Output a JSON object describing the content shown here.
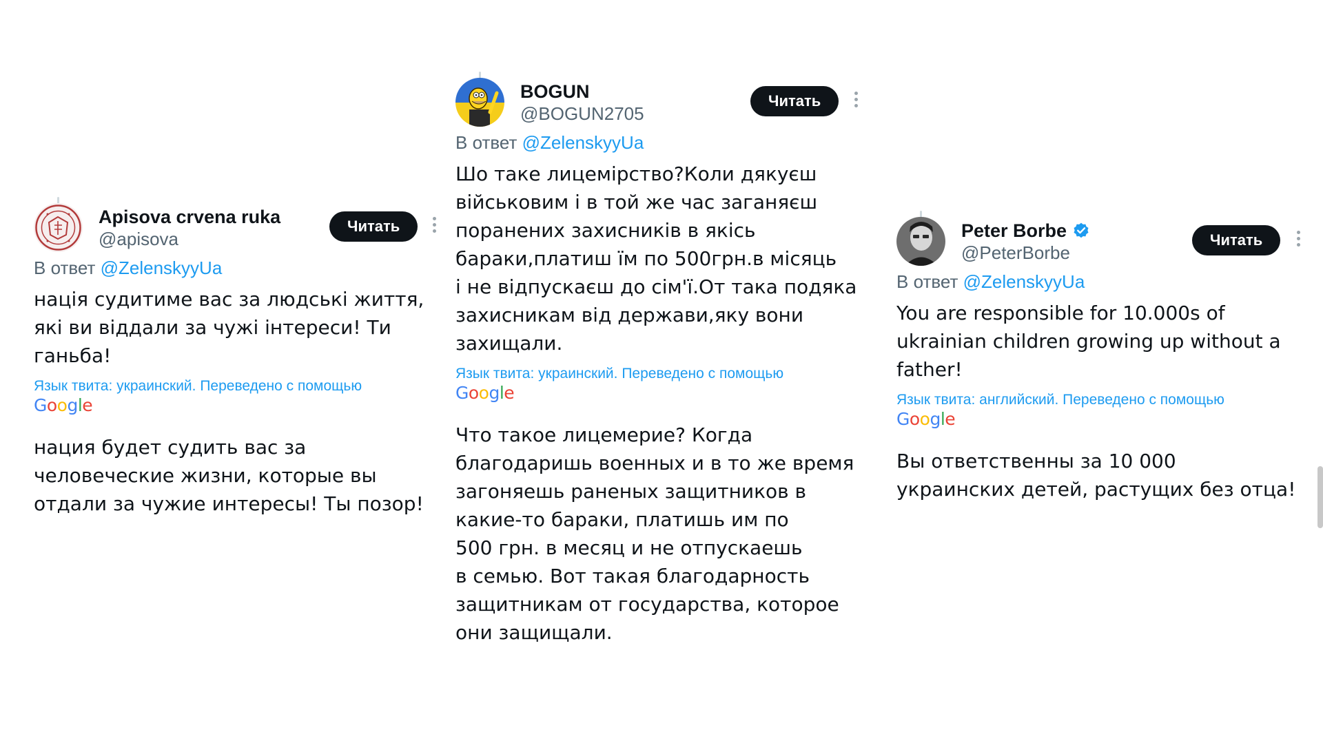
{
  "tweets": [
    {
      "display_name": "Apisova crvena ruka",
      "handle": "@apisova",
      "follow_label": "Читать",
      "reply_prefix": "В ответ",
      "reply_to": "@ZelenskyyUa",
      "text": "нація судитиме вас за людські життя,\nякі ви віддали за чужі інтереси! Ти\nганьба!",
      "translate_note": "Язык твита: украинский. Переведено с помощью",
      "translated_text": "нация будет судить вас за\nчеловеческие жизни, которые вы\nотдали за чужие интересы! Ты позор!",
      "avatar_icon": "seal-emblem-avatar",
      "verified": false
    },
    {
      "display_name": "BOGUN",
      "handle": "@BOGUN2705",
      "follow_label": "Читать",
      "reply_prefix": "В ответ",
      "reply_to": "@ZelenskyyUa",
      "text": "Шо таке лицемірство?Коли дякуєш\nвійськовим і в той же час заганяєш\nпоранених захисників в якісь\nбараки,платиш їм по 500грн.в місяць\nі не відпускаєш до сім'ї.От така подяка\nзахисникам від держави,яку вони\nзахищали.",
      "translate_note": "Язык твита: украинский. Переведено с помощью",
      "translated_text": "Что такое лицемерие? Когда\nблагодаришь военных и в то же время\nзагоняешь раненых защитников в\nкакие-то бараки, платишь им по\n500 грн. в месяц и не отпускаешь\nв семью. Вот такая благодарность\nзащитникам от государства, которое\nони защищали.",
      "avatar_icon": "cartoon-character-avatar",
      "verified": false
    },
    {
      "display_name": "Peter Borbe",
      "handle": "@PeterBorbe",
      "follow_label": "Читать",
      "reply_prefix": "В ответ",
      "reply_to": "@ZelenskyyUa",
      "text": "You are responsible for 10.000s of\nukrainian children growing up without a\nfather!",
      "translate_note": "Язык твита: английский. Переведено с помощью",
      "translated_text": "Вы ответственны за 10 000\nукраинских детей, растущих без отца!",
      "avatar_icon": "profile-photo-avatar",
      "verified": true
    }
  ],
  "google_logo": {
    "letters": [
      "G",
      "o",
      "o",
      "g",
      "l",
      "e"
    ],
    "colors": [
      "#4285f4",
      "#ea4335",
      "#fbbc05",
      "#4285f4",
      "#34a853",
      "#ea4335"
    ]
  },
  "colors": {
    "link": "#1d9bf0",
    "text": "#0f1419",
    "secondary": "#536471",
    "button_bg": "#0f1419",
    "verified": "#1d9bf0"
  }
}
